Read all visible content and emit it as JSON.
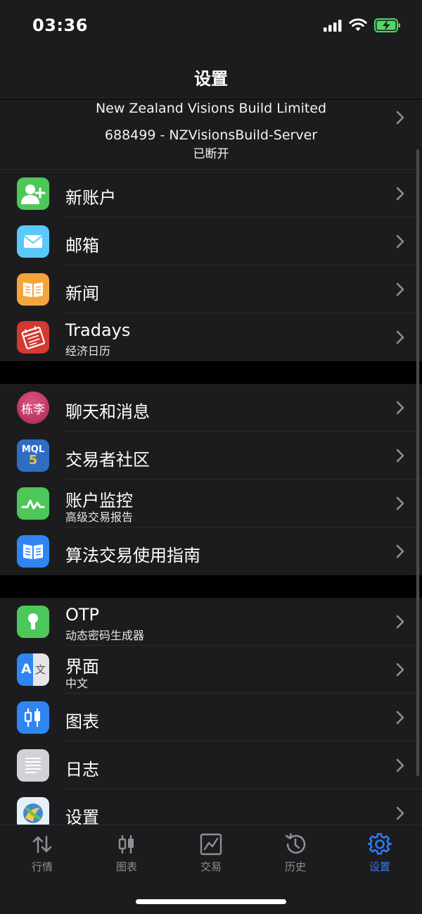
{
  "status": {
    "time": "03:36"
  },
  "nav": {
    "title": "设置"
  },
  "account": {
    "company": "New Zealand Visions Build Limited",
    "server": "688499 - NZVisionsBuild-Server",
    "connection": "已断开"
  },
  "groups": {
    "accounts": [
      {
        "label": "新账户",
        "icon": "add-user-icon",
        "color": "#4cc75a"
      },
      {
        "label": "邮箱",
        "icon": "mail-icon",
        "color": "#5ac8fa"
      },
      {
        "label": "新闻",
        "icon": "book-icon",
        "color": "#f4a43b"
      },
      {
        "label": "Tradays",
        "sub": "经济日历",
        "icon": "calendar-icon",
        "color": "#d23a32"
      }
    ],
    "community": [
      {
        "label": "聊天和消息",
        "icon": "avatar",
        "avatar_text": "栋李",
        "color": "#c53a6b"
      },
      {
        "label": "交易者社区",
        "icon": "mql5-icon",
        "icon_text": "MQL",
        "icon_num": "5",
        "color": "#2f6cc4"
      },
      {
        "label": "账户监控",
        "sub": "高级交易报告",
        "icon": "monitoring-icon",
        "color": "#4cc75a"
      },
      {
        "label": "算法交易使用指南",
        "icon": "guide-book-icon",
        "color": "#2f86f2"
      }
    ],
    "app": [
      {
        "label": "OTP",
        "sub": "动态密码生成器",
        "icon": "keyhole-icon",
        "color": "#4cc75a"
      },
      {
        "label": "界面",
        "sub": "中文",
        "icon": "translate-icon",
        "icon_a": "A",
        "icon_b": "文",
        "color": "#2f86f2"
      },
      {
        "label": "图表",
        "icon": "candlestick-icon",
        "color": "#2f86f2"
      },
      {
        "label": "日志",
        "icon": "journal-icon",
        "color": "#d1d1d6"
      },
      {
        "label": "设置",
        "icon": "metatrader-icon",
        "color": "#e6f0f7"
      }
    ]
  },
  "tabs": [
    {
      "label": "行情",
      "icon": "quotes-icon"
    },
    {
      "label": "图表",
      "icon": "charts-icon"
    },
    {
      "label": "交易",
      "icon": "trade-icon"
    },
    {
      "label": "历史",
      "icon": "history-icon"
    },
    {
      "label": "设置",
      "icon": "settings-gear-icon",
      "active": true
    }
  ],
  "colors": {
    "accent": "#2f7bf5",
    "background": "#000000",
    "surface": "#1c1c1e",
    "inactive": "#8e8e93"
  }
}
